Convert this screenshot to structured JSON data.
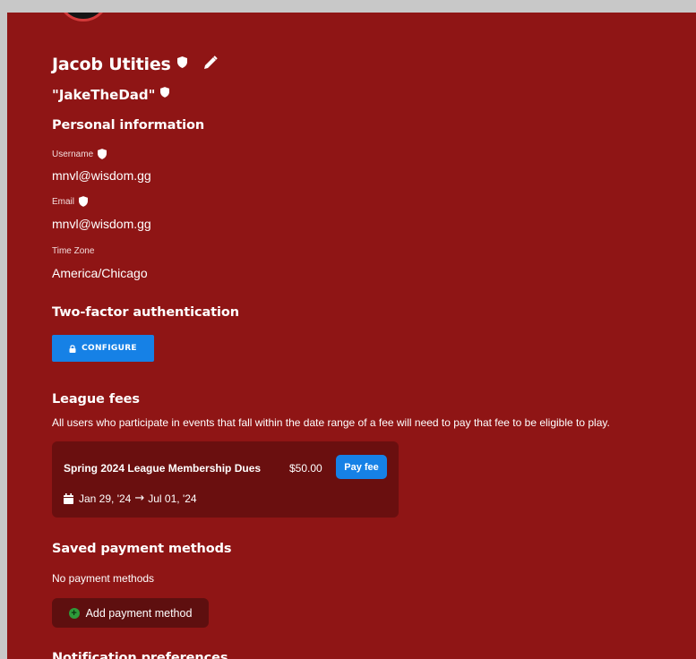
{
  "profile": {
    "name": "Jacob Utities",
    "nickname": "\"JakeTheDad\""
  },
  "personal": {
    "heading": "Personal information",
    "username_label": "Username",
    "username_value": "mnvl@wisdom.gg",
    "email_label": "Email",
    "email_value": "mnvl@wisdom.gg",
    "timezone_label": "Time Zone",
    "timezone_value": "America/Chicago"
  },
  "two_factor": {
    "heading": "Two-factor authentication",
    "button_label": "CONFIGURE"
  },
  "league_fees": {
    "heading": "League fees",
    "description": "All users who participate in events that fall within the date range of a fee will need to pay that fee to be eligible to play.",
    "fees": [
      {
        "title": "Spring 2024 League Membership Dues",
        "amount": "$50.00",
        "pay_label": "Pay fee",
        "start": "Jan 29, '24",
        "end": "Jul 01, '24"
      }
    ]
  },
  "payment_methods": {
    "heading": "Saved payment methods",
    "empty_text": "No payment methods",
    "add_label": "Add payment method"
  },
  "notifications": {
    "heading": "Notification preferences"
  },
  "colors": {
    "page_bg": "#8f1515",
    "card_bg": "#6a0f0f",
    "accent": "#1681e6",
    "success": "#2e9a3a"
  },
  "icons": {
    "shield": "shield-icon",
    "pencil": "pencil-icon",
    "lock": "lock-icon",
    "calendar": "calendar-icon",
    "arrow": "arrow-right-icon",
    "plus": "plus-circle-icon"
  }
}
